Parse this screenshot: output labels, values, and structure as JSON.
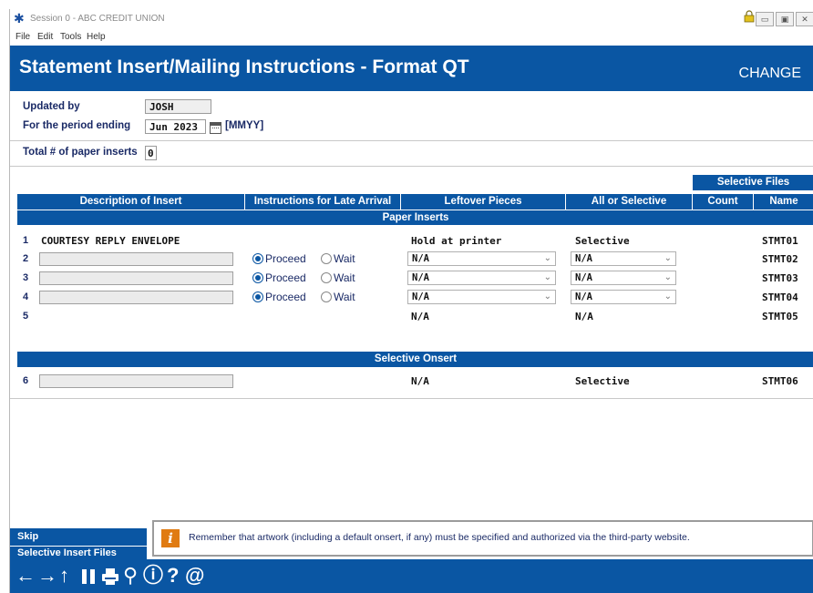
{
  "window": {
    "session_title": "Session 0 - ABC CREDIT UNION",
    "menu": [
      "File",
      "Edit",
      "Tools",
      "Help"
    ]
  },
  "header": {
    "title": "Statement Insert/Mailing Instructions - Format QT",
    "mode": "CHANGE"
  },
  "form": {
    "updated_by_label": "Updated by",
    "updated_by_value": "JOSH",
    "period_label": "For the period ending",
    "period_value": "Jun 2023",
    "period_hint": "[MMYY]",
    "total_label": "Total # of paper inserts",
    "total_value": "0"
  },
  "table": {
    "selective_files_header": "Selective Files",
    "columns": {
      "description": "Description of Insert",
      "instructions": "Instructions for Late Arrival",
      "leftover": "Leftover Pieces",
      "all_or_selective": "All or Selective",
      "count": "Count",
      "name": "Name"
    },
    "paper_inserts_header": "Paper Inserts",
    "selective_onsert_header": "Selective Onsert",
    "proceed_label": "Proceed",
    "wait_label": "Wait",
    "rows": [
      {
        "num": "1",
        "description": "COURTESY REPLY ENVELOPE",
        "leftover": "Hold at printer",
        "selective": "Selective",
        "name": "STMT01"
      },
      {
        "num": "2",
        "leftover": "N/A",
        "selective": "N/A",
        "name": "STMT02"
      },
      {
        "num": "3",
        "leftover": "N/A",
        "selective": "N/A",
        "name": "STMT03"
      },
      {
        "num": "4",
        "leftover": "N/A",
        "selective": "N/A",
        "name": "STMT04"
      },
      {
        "num": "5",
        "leftover": "N/A",
        "selective": "N/A",
        "name": "STMT05"
      },
      {
        "num": "6",
        "leftover": "N/A",
        "selective": "Selective",
        "name": "STMT06"
      }
    ]
  },
  "side_buttons": {
    "skip": "Skip",
    "selective_insert_files": "Selective Insert Files"
  },
  "notice": {
    "icon_letter": "i",
    "text": "Remember that artwork (including a default onsert, if any) must be specified and authorized via the third-party website."
  },
  "toolbar": {
    "icons": [
      "back-arrow-icon",
      "forward-arrow-icon",
      "up-arrow-icon",
      "pause-icon",
      "print-icon",
      "link-icon",
      "info-icon",
      "help-icon",
      "at-icon"
    ]
  },
  "colors": {
    "brand_blue": "#0a56a3",
    "label_navy": "#1a2a66",
    "notice_orange": "#e07b12"
  }
}
